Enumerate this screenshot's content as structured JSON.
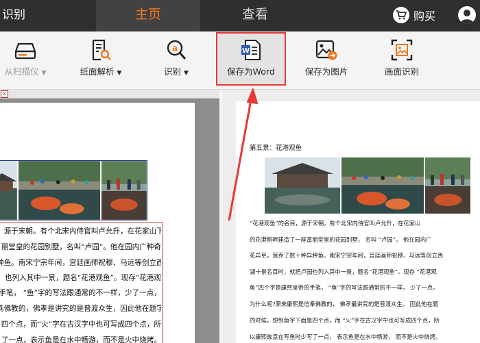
{
  "topbar": {
    "left_title": "识别",
    "tabs": [
      {
        "label": "主页",
        "active": true
      },
      {
        "label": "查看",
        "active": false
      }
    ],
    "buy_label": "购买"
  },
  "toolbar": {
    "tools": [
      {
        "label": "从扫描仪",
        "icon": "scanner-icon",
        "has_dropdown": true,
        "disabled": true
      },
      {
        "label": "纸面解析",
        "icon": "document-search-icon",
        "has_dropdown": true
      },
      {
        "label": "识别",
        "icon": "ocr-search-icon",
        "has_dropdown": true
      },
      {
        "label": "保存为Word",
        "icon": "word-file-icon",
        "has_dropdown": false,
        "highlighted": true
      },
      {
        "label": "保存为图片",
        "icon": "save-image-icon",
        "has_dropdown": false
      },
      {
        "label": "画面识别",
        "icon": "screen-capture-icon",
        "has_dropdown": false
      }
    ],
    "dropdown_glyph": "▼"
  },
  "left_document": {
    "close_glyph": "x",
    "lines": [
      "，源于宋朝。有个北宋内侍官叫卢允升，在花家山下",
      "丽堂皇的花园别墅，名叫“卢园”。他在园内广种奇",
      "种鱼。南宋宁宗年间，宫廷画师祝穆、马远等创立西",
      "也列入其中一景，题名“花港观鱼”。现存“花港观",
      "手笔，  “鱼”字的写法跟通常的不一样，少了一点，",
      "笃佛教的，佛孝是讲究的是普渡众生，因此他在题字",
      "四个点，而“火”字在古汉字中也可写成四个点，所",
      "了一点，表示鱼是在水中畅游，而不是火中烧烤。"
    ]
  },
  "right_document": {
    "heading": "第五景：花港观鱼",
    "lines": [
      "“花港观鱼”的名目，源于宋朝。有个北宋内侍官叫卢允升，在花家山",
      "的花港侧畔建造了一座富丽堂皇的花园别墅， 名叫 “卢园”。 他在园内广",
      "花异草，营养了数十种异种鱼。南宋宁宗年间，宫廷画师祝穆、马远等创立西",
      "湖十景名目时，就把卢园也列入其中一景，题名“花港观鱼”。现存 “花港观",
      "鱼”四个字是康熙皇帝的手笔，     “鱼”字的写法跟通常的不一样， 少了一点。",
      "为什么呢?原来康熙是信奉佛教的， 佛孝最讲究的是普渡众生。 因此他在题",
      "的时候，想到鱼字下面是四个点，而 “火”字在古汉字中也可写成四个点，所",
      "以康熙故意在写鱼时少写了一点， 表示鱼是在水中畅游， 而不是火中烧烤。"
    ]
  },
  "colors": {
    "topbar_bg": "#2f2f30",
    "active_tab": "#f4741c",
    "highlight": "#e53935",
    "toolbar_bg": "#f4f4f4"
  }
}
